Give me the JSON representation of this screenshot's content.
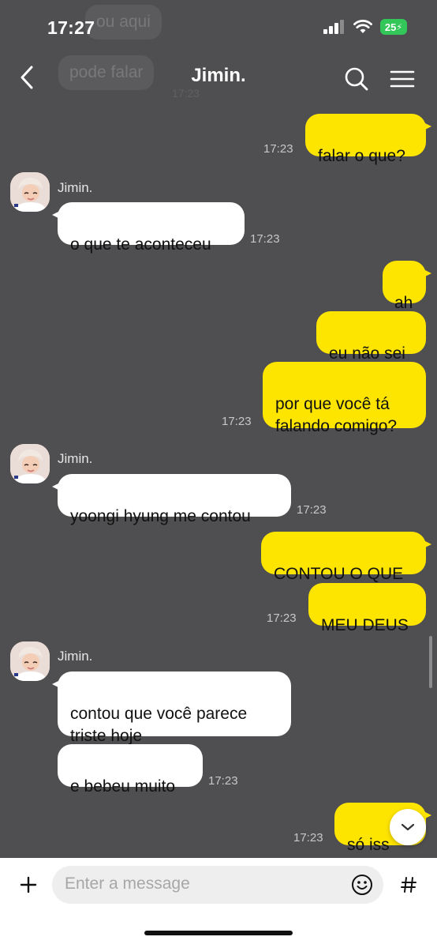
{
  "status": {
    "time": "17:27",
    "battery": "25"
  },
  "background_faded": [
    {
      "text": "contou aqui",
      "visible": "ou aqui"
    },
    {
      "text": "pode falar"
    },
    {
      "time": "17:23"
    }
  ],
  "header": {
    "title": "Jimin."
  },
  "messages": [
    {
      "from": "me",
      "text": "falar o que?",
      "time": "17:23"
    },
    {
      "from": "them",
      "sender": "Jimin.",
      "text": "o que te aconteceu",
      "time": "17:23"
    },
    {
      "from": "me",
      "text": "ah"
    },
    {
      "from": "me",
      "text": "eu não sei"
    },
    {
      "from": "me",
      "text": "por que você tá\nfalando comigo?",
      "time": "17:23"
    },
    {
      "from": "them",
      "sender": "Jimin.",
      "text": "yoongi hyung me contou",
      "time": "17:23"
    },
    {
      "from": "me",
      "text": "CONTOU O QUE"
    },
    {
      "from": "me",
      "text": "MEU DEUS",
      "time": "17:23"
    },
    {
      "from": "them",
      "sender": "Jimin.",
      "text": "contou que você parece\ntriste hoje"
    },
    {
      "from": "them",
      "text": "e bebeu muito",
      "time": "17:23"
    },
    {
      "from": "me",
      "text": "só iss",
      "time": "17:23"
    }
  ],
  "composer": {
    "placeholder": "Enter a message"
  },
  "icons": {
    "back": "chevron-left-icon",
    "search": "search-icon",
    "menu": "menu-icon",
    "add": "plus-icon",
    "emoji": "emoji-icon",
    "hashtag": "hashtag-icon",
    "scroll_down": "chevron-down-icon"
  },
  "colors": {
    "bg": "#4f4e50",
    "my_bubble": "#fee500",
    "their_bubble": "#ffffff",
    "battery": "#33c759"
  }
}
